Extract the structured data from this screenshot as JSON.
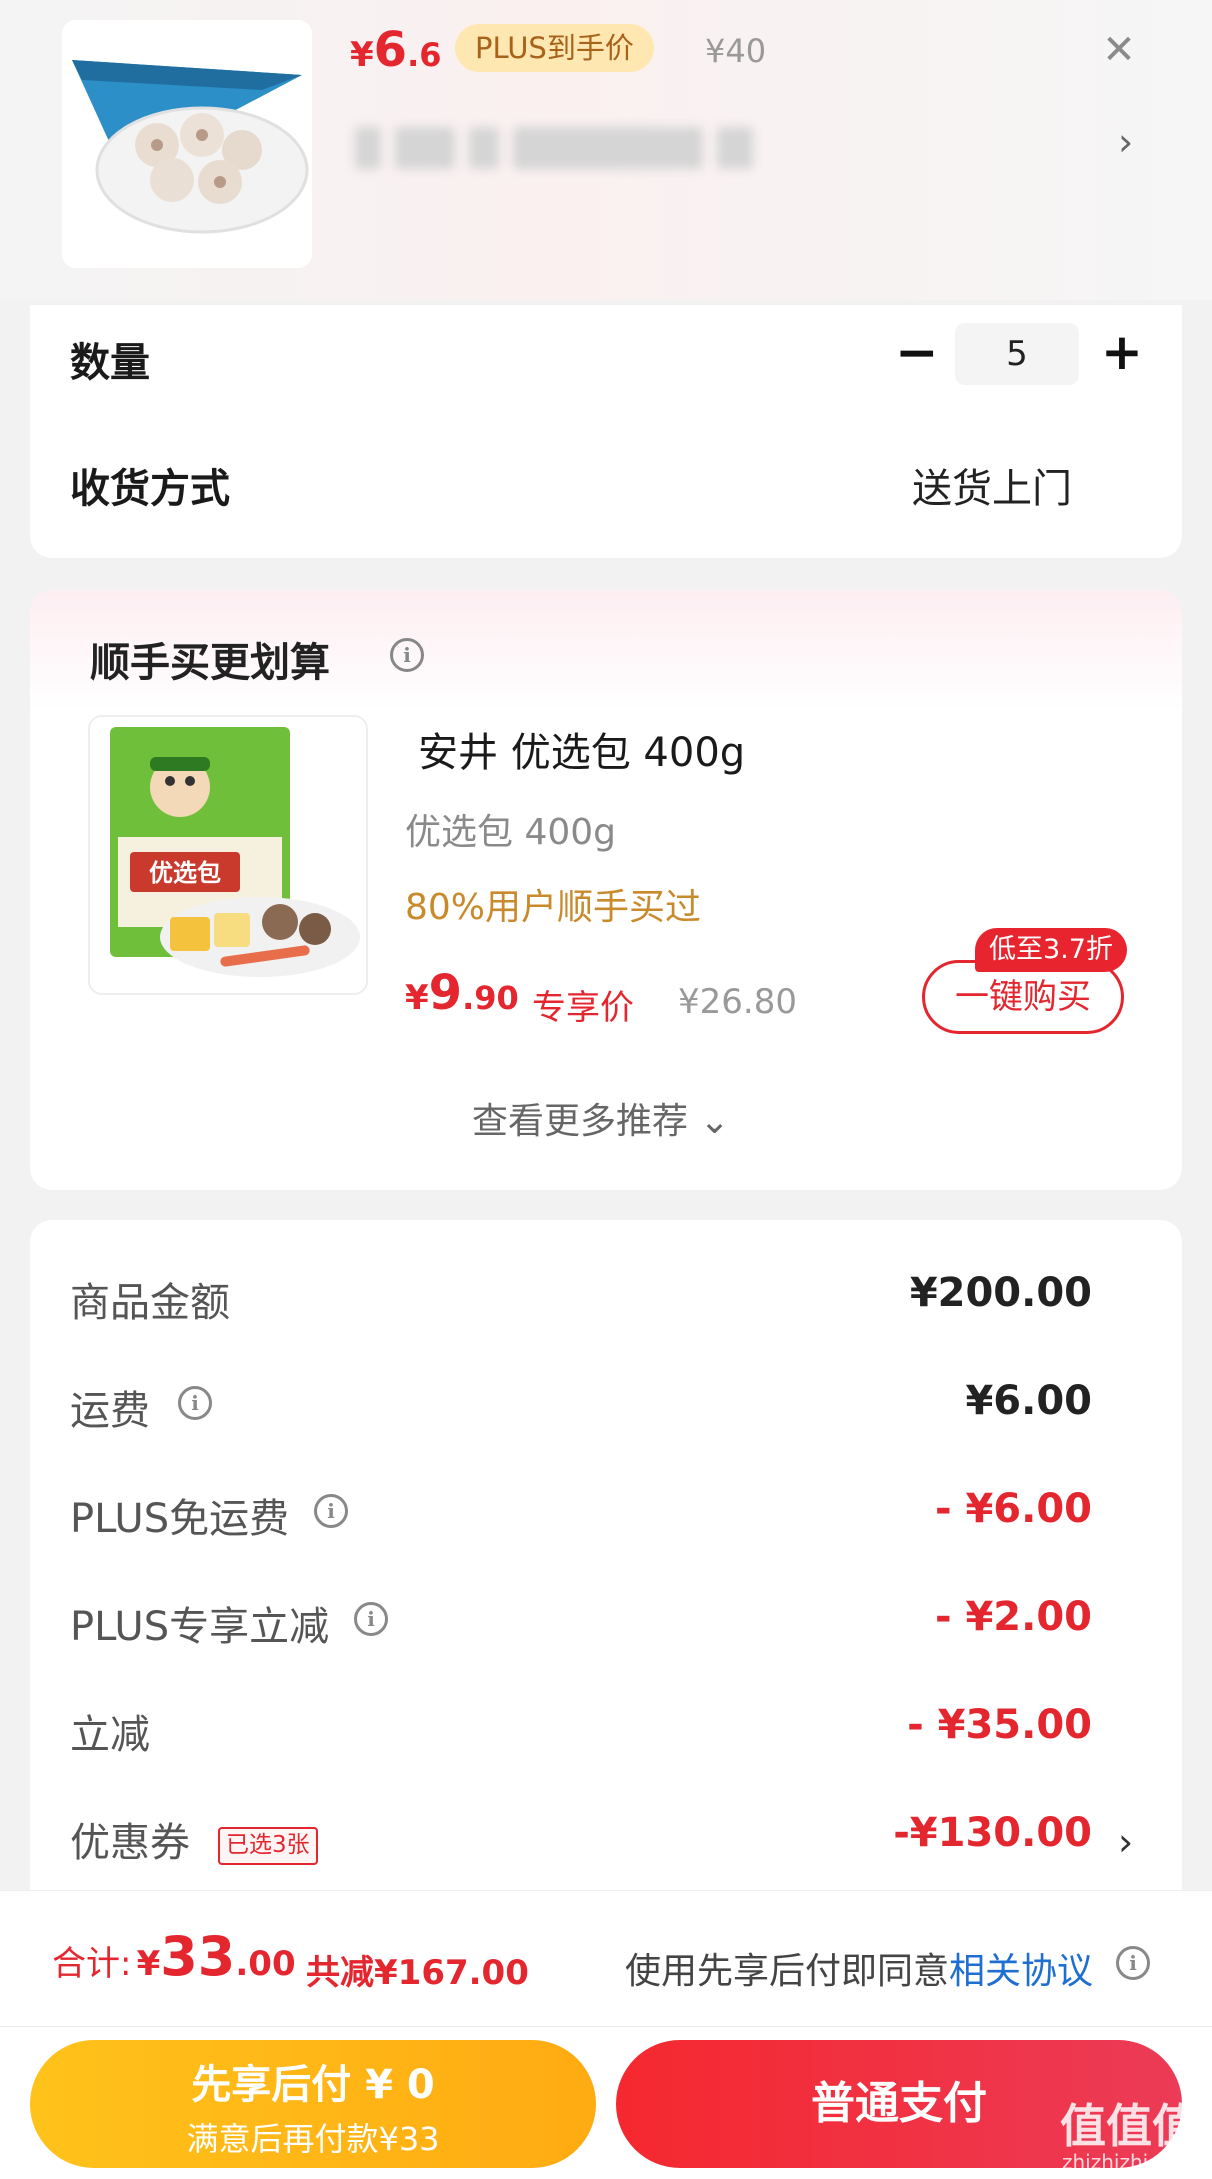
{
  "product": {
    "price_symbol": "¥",
    "price_int": "6",
    "price_dec": ".6",
    "plus_tag": "PLUS到手价",
    "original_price": "¥40",
    "close_icon": "✕",
    "chevron": "›"
  },
  "order": {
    "quantity_label": "数量",
    "quantity_minus": "−",
    "quantity_value": "5",
    "quantity_plus": "+",
    "shipping_label": "收货方式",
    "shipping_value": "送货上门"
  },
  "recommend": {
    "title": "顺手买更划算",
    "info_icon": "i",
    "item_name": "安井 优选包 400g",
    "item_spec": "优选包 400g",
    "item_bought": "80%用户顺手买过",
    "price_symbol": "¥",
    "price_int": "9",
    "price_dec": ".90",
    "exclusive_label": "专享价",
    "original_price": "¥26.80",
    "discount_tag": "低至3.7折",
    "buy_button": "一键购买",
    "more": "查看更多推荐 ⌄"
  },
  "summary": {
    "rows": [
      {
        "label": "商品金额",
        "value": "¥200.00",
        "info": false,
        "red": false
      },
      {
        "label": "运费",
        "value": "¥6.00",
        "info": true,
        "red": false
      },
      {
        "label": "PLUS免运费",
        "value": "- ¥6.00",
        "info": true,
        "red": true
      },
      {
        "label": "PLUS专享立减",
        "value": "- ¥2.00",
        "info": true,
        "red": true
      },
      {
        "label": "立减",
        "value": "- ¥35.00",
        "info": false,
        "red": true
      },
      {
        "label": "优惠券",
        "value": "-¥130.00",
        "info": false,
        "red": true
      }
    ],
    "coupon_tag": "已选3张",
    "coupon_chevron": "›"
  },
  "footer": {
    "total_label": "合计:",
    "total_symbol": "¥",
    "total_int": "33",
    "total_dec": ".00",
    "total_saved": "共减¥167.00",
    "agree_prefix": "使用先享后付即同意",
    "agree_link": "相关协议",
    "pay_later_title": "先享后付 ¥ 0",
    "pay_later_sub": "满意后再付款¥33",
    "pay_button": "普通支付"
  },
  "watermark": {
    "logo": "值值值",
    "url": "zhizhizhi.com"
  },
  "colors": {
    "accent_red": "#e4262f",
    "gold": "#ffb416",
    "link_blue": "#1f6fd1"
  }
}
